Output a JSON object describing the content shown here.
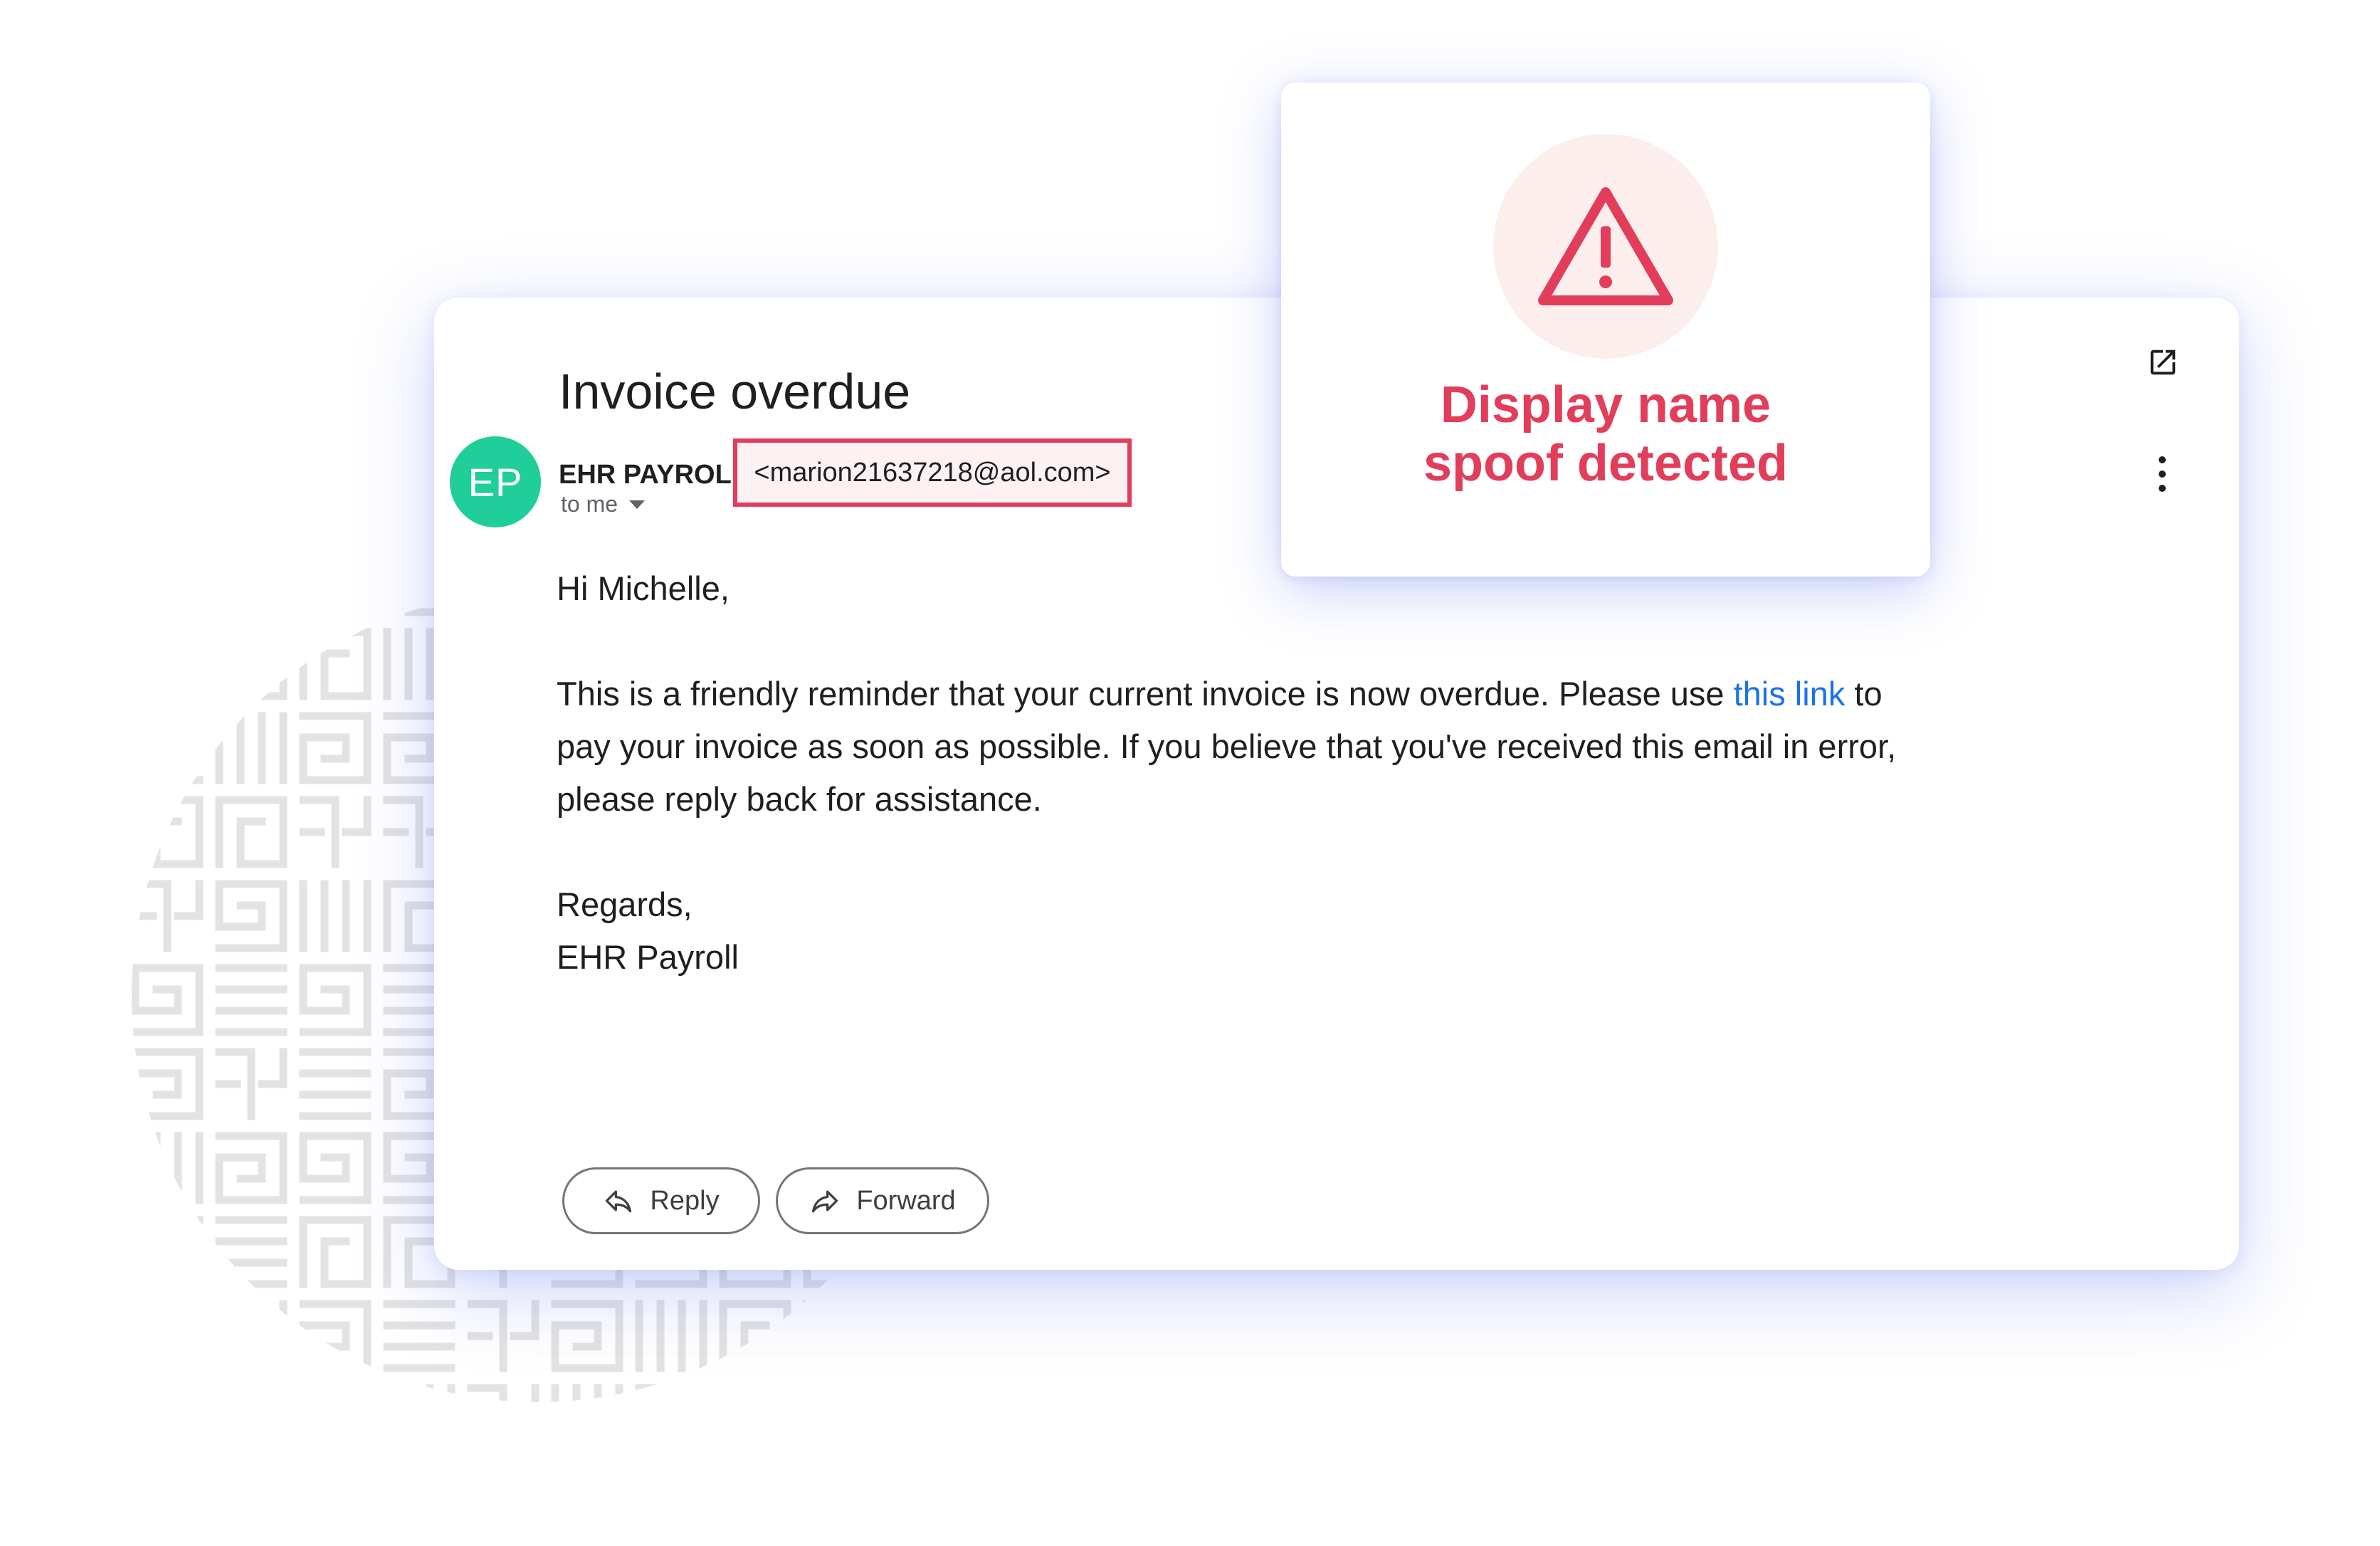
{
  "email": {
    "subject": "Invoice overdue",
    "avatar_initials": "EP",
    "sender_name": "EHR PAYROLL",
    "sender_email": "<marion21637218@aol.com>",
    "recipient_label": "to me",
    "greeting": "Hi Michelle,",
    "paragraph_part1": "This is a friendly reminder that your current invoice is now overdue. Please use ",
    "link_text": "this link",
    "paragraph_part2": " to",
    "paragraph_line2": "pay your invoice as soon as possible. If you believe that you've received this email in error,",
    "paragraph_line3": "please reply back for assistance.",
    "closing": "Regards,",
    "signature": "EHR Payroll",
    "reply_label": "Reply",
    "forward_label": "Forward"
  },
  "warning": {
    "line1": "Display name",
    "line2": "spoof detected"
  },
  "colors": {
    "avatar": "#1fce98",
    "alert": "#e23d5a",
    "link": "#1a73e8"
  },
  "icons": {
    "header_open": "open-in-new-icon",
    "header_more": "more-vert-icon",
    "reply": "reply-arrow-icon",
    "forward": "forward-arrow-icon",
    "warning": "warning-triangle-icon"
  }
}
